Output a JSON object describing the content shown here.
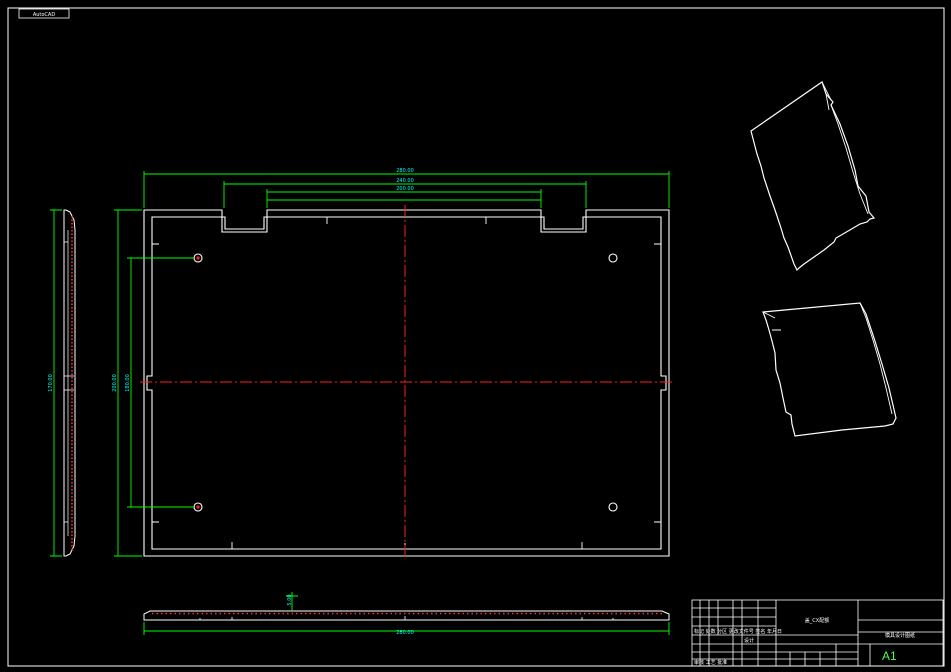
{
  "drawing": {
    "corner_label": "AutoCAD",
    "sheet_size": "A1",
    "title_main": "盖_CX配额",
    "title_right": "模具设计图纸",
    "tb_row_text": "标记 处数 分区 更改文件号 签名 年月日",
    "tb_sub_text": "设计",
    "tb_bottom_text": "审核 工艺 批准"
  },
  "dimensions": {
    "top_overall": "280.00",
    "top_slot": "240.00",
    "top_inner": "200.00",
    "left_height": "200.00",
    "left_hole_span": "180.00",
    "side_view_height": "170.00",
    "bottom_width": "280.00",
    "bottom_thickness": "5.00"
  },
  "colors": {
    "background": "#000000",
    "outline": "#ffffff",
    "dimension": "#00ff00",
    "dim_text": "#00ffff",
    "centerline": "#ff0000"
  }
}
